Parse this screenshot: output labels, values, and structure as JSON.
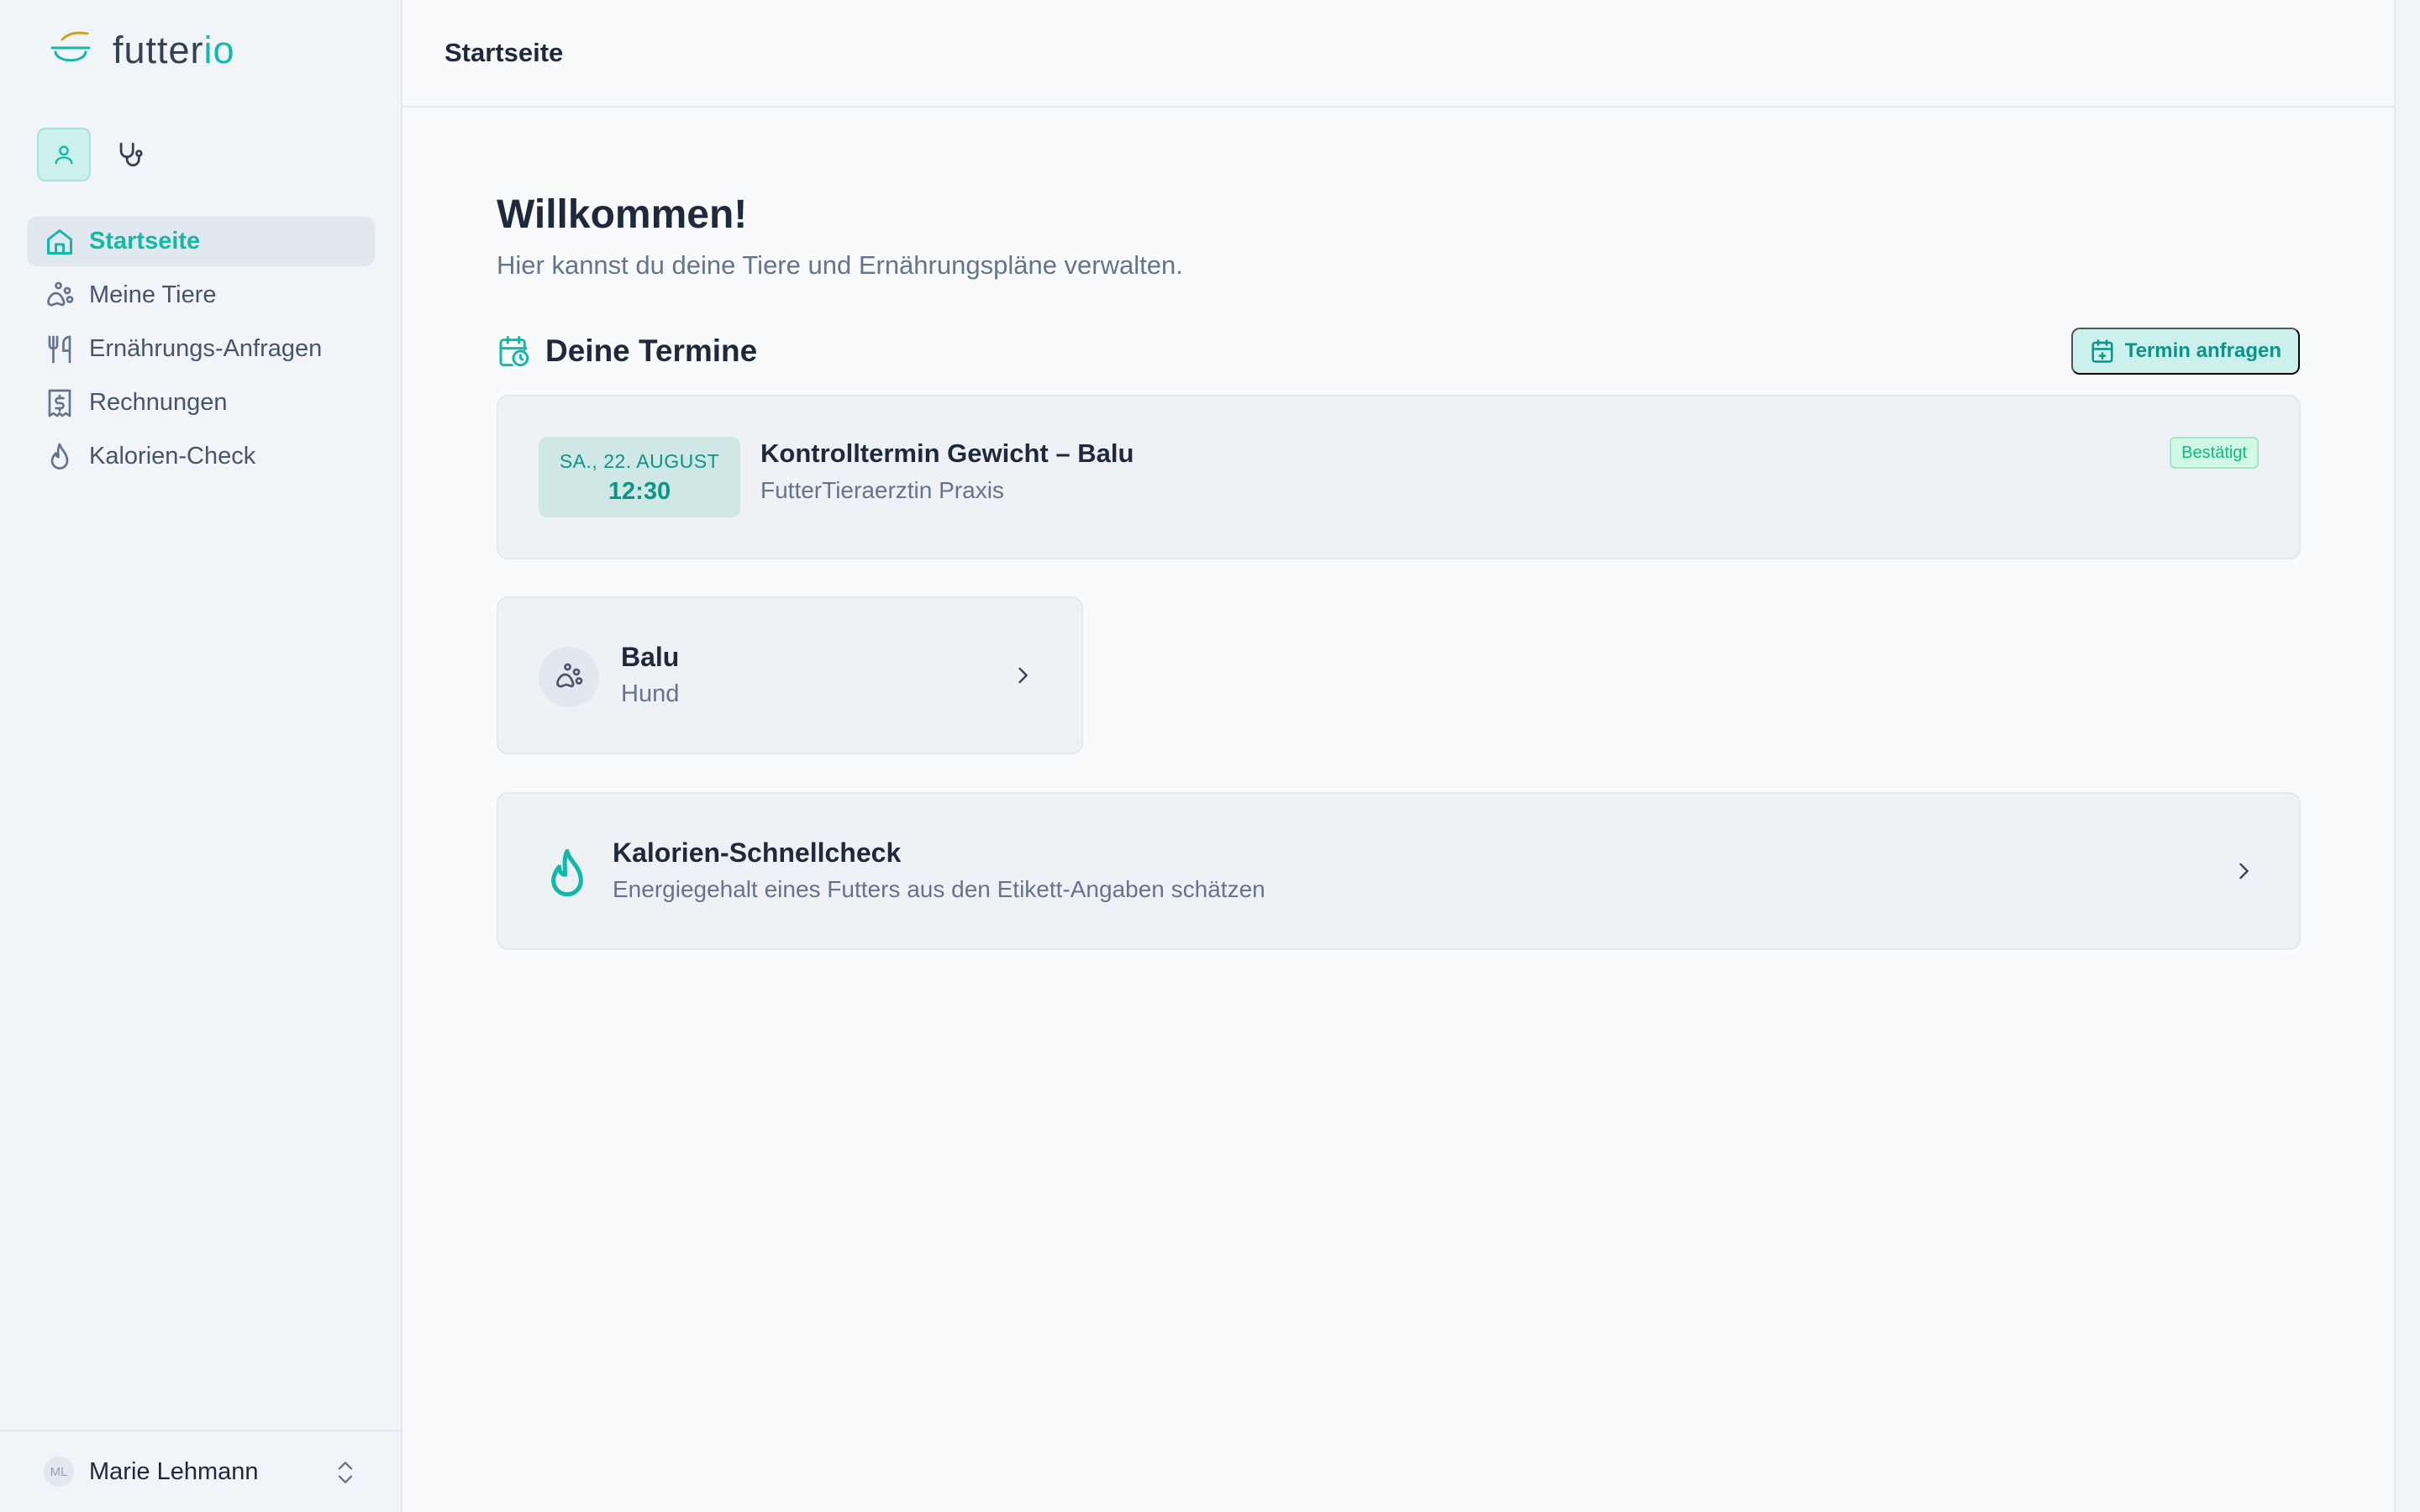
{
  "app": {
    "logo_text_main": "futter",
    "logo_text_accent": "io"
  },
  "sidebar": {
    "modes": [
      {
        "name": "user-mode",
        "icon": "user-icon",
        "active": true
      },
      {
        "name": "vet-mode",
        "icon": "stethoscope-icon",
        "active": false
      }
    ],
    "items": [
      {
        "label": "Startseite",
        "icon": "home-icon",
        "active": true
      },
      {
        "label": "Meine Tiere",
        "icon": "paw-icon",
        "active": false
      },
      {
        "label": "Ernährungs-Anfragen",
        "icon": "utensils-icon",
        "active": false
      },
      {
        "label": "Rechnungen",
        "icon": "receipt-icon",
        "active": false
      },
      {
        "label": "Kalorien-Check",
        "icon": "flame-icon",
        "active": false
      }
    ],
    "user": {
      "initials": "ML",
      "name": "Marie Lehmann"
    }
  },
  "header": {
    "title": "Startseite"
  },
  "main": {
    "welcome_title": "Willkommen!",
    "welcome_subtitle": "Hier kannst du deine Tiere und Ernährungspläne verwalten.",
    "appointments_title": "Deine Termine",
    "request_button": "Termin anfragen",
    "appointment": {
      "date": "SA., 22. AUGUST",
      "time": "12:30",
      "title": "Kontrolltermin Gewicht – Balu",
      "location": "FutterTieraerztin Praxis",
      "status": "Bestätigt"
    },
    "pet": {
      "name": "Balu",
      "type": "Hund"
    },
    "calorie_check": {
      "title": "Kalorien-Schnellcheck",
      "subtitle": "Energiegehalt eines Futters aus den Etikett-Angaben schätzen"
    }
  },
  "colors": {
    "accent": "#14b8a6",
    "accent_dark": "#0d9488",
    "text": "#1e293b",
    "muted": "#64748b",
    "background": "#f8fafc"
  }
}
